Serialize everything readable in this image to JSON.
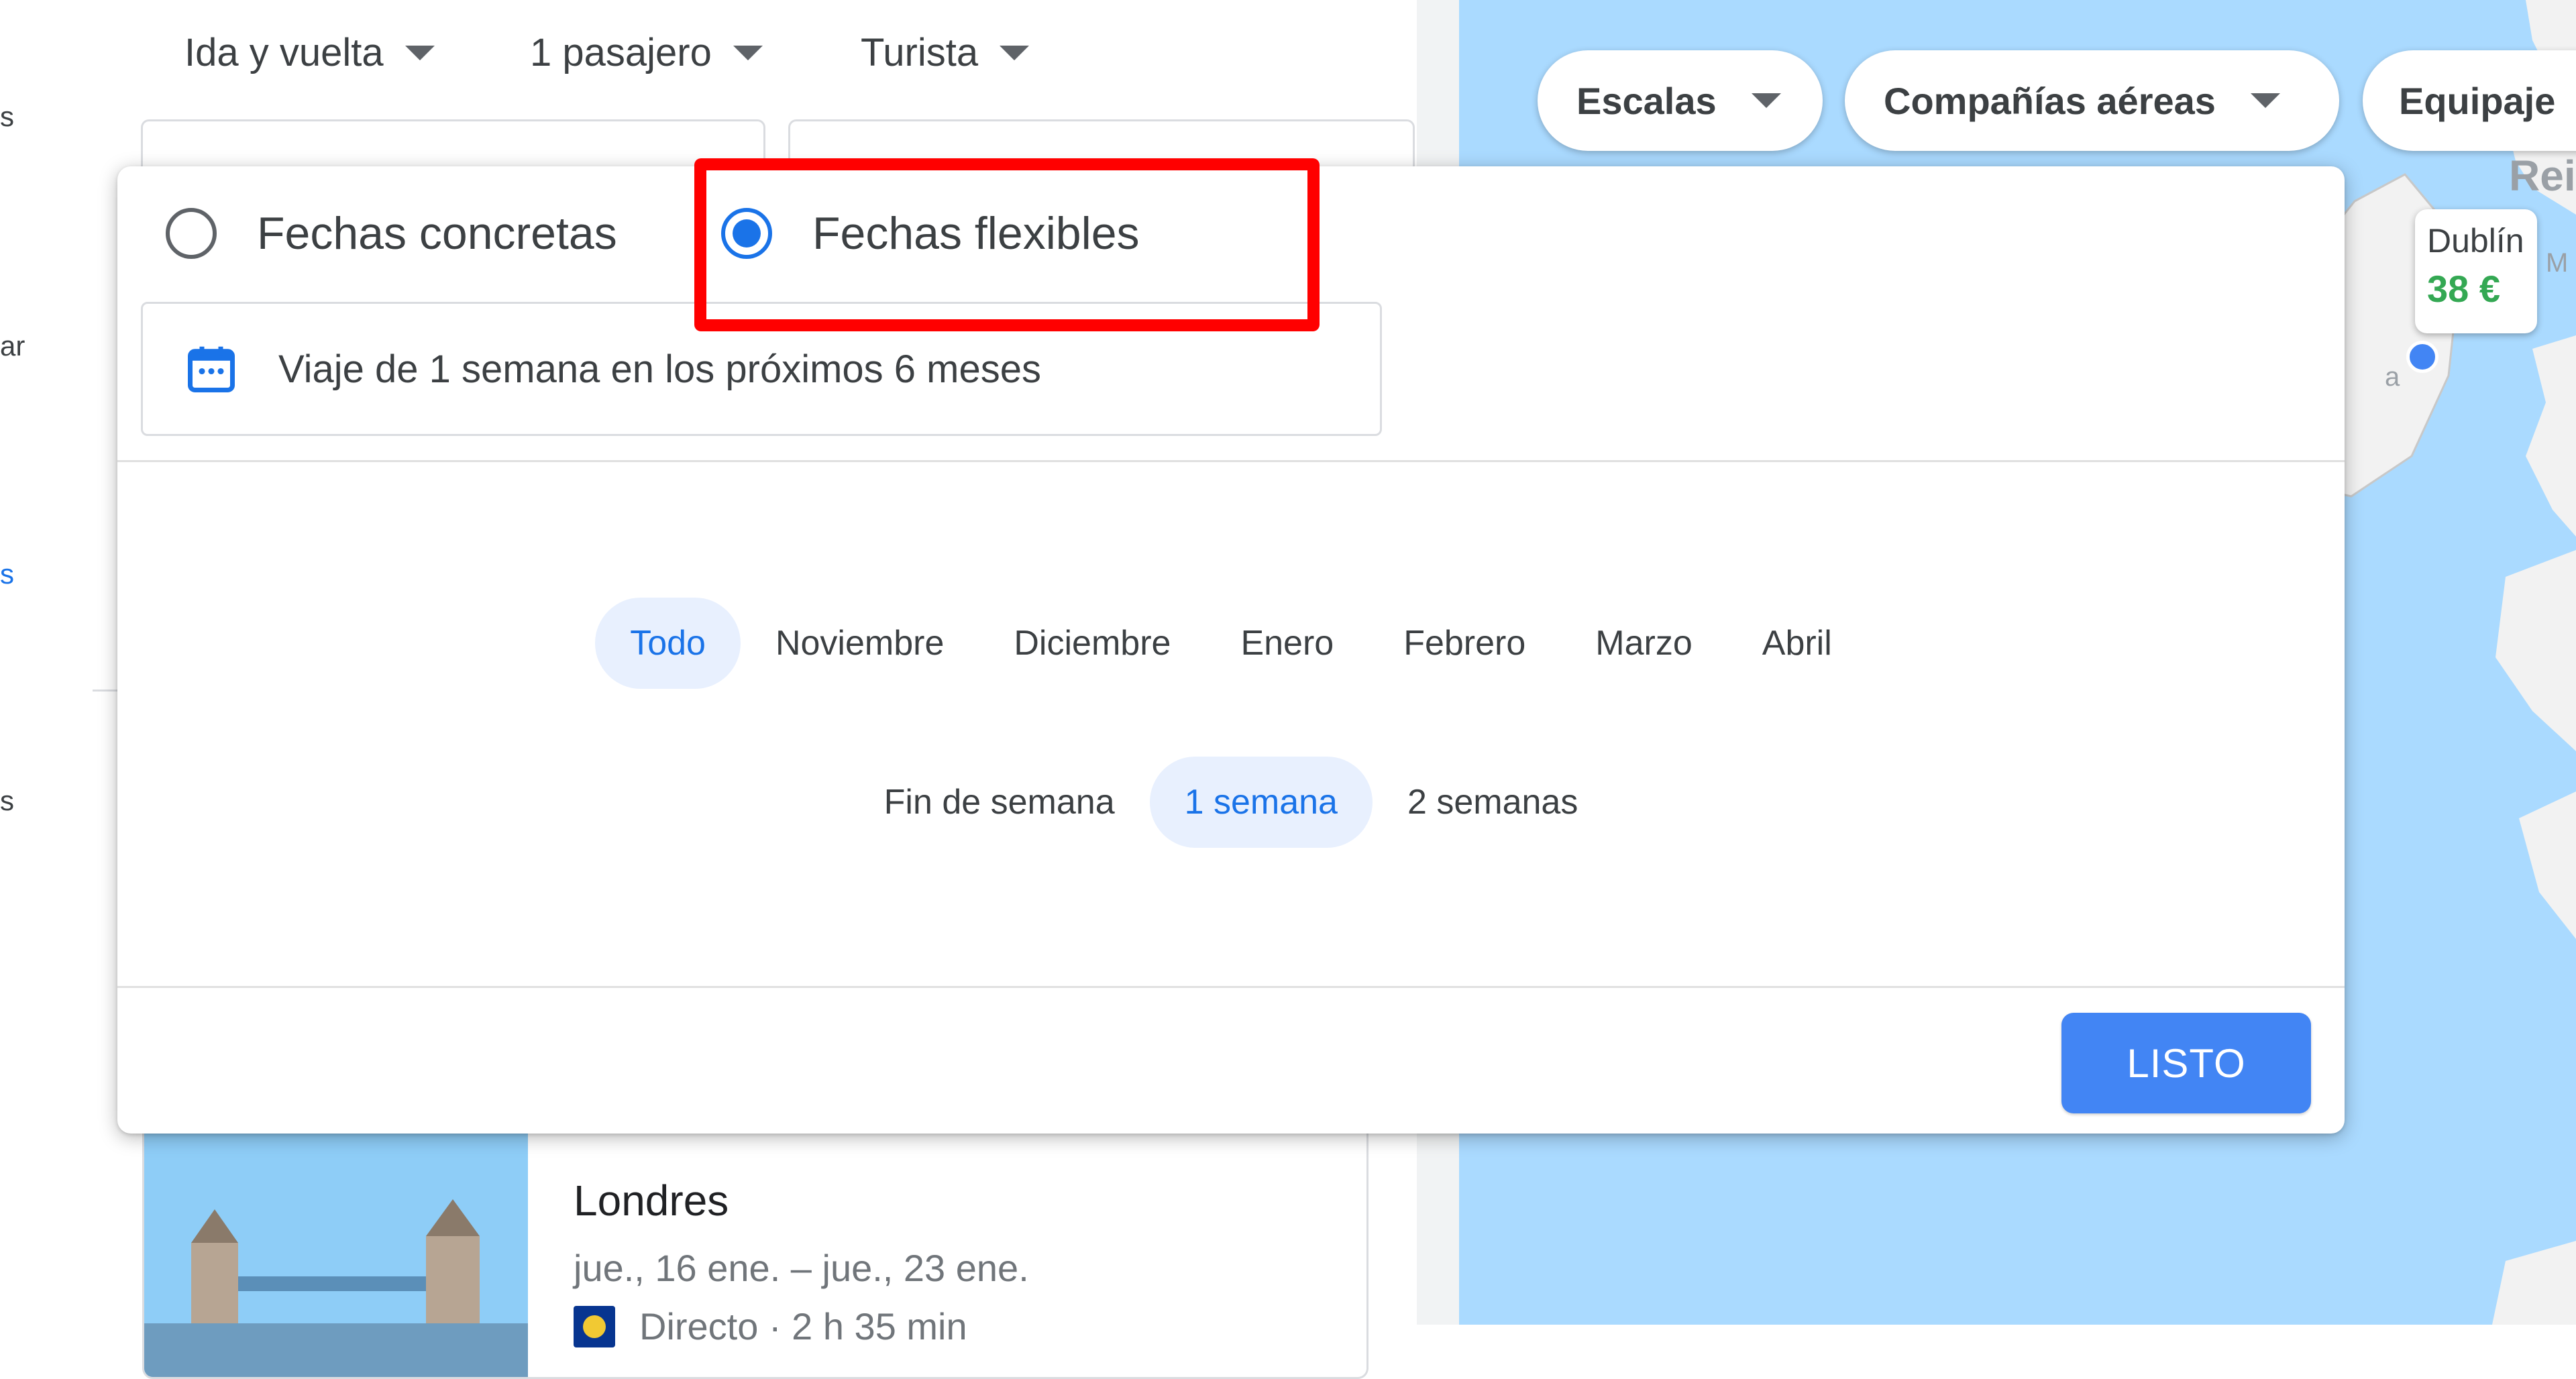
{
  "top_controls": {
    "trip_type": "Ida y vuelta",
    "passengers": "1 pasajero",
    "cabin": "Turista"
  },
  "sidebar_fragments": [
    "s",
    "ar",
    "s",
    "s"
  ],
  "map": {
    "filters": [
      "Escalas",
      "Compañías aéreas",
      "Equipaje"
    ],
    "destination_tag": {
      "city": "Dublín",
      "price": "38 €"
    },
    "fragments": [
      "Rei",
      "M",
      "a"
    ],
    "colors": {
      "water": "#aadaff",
      "land": "#f2f2f2",
      "price": "#34a853"
    }
  },
  "date_popup": {
    "mode_options": [
      {
        "label": "Fechas concretas",
        "selected": false
      },
      {
        "label": "Fechas flexibles",
        "selected": true
      }
    ],
    "summary": "Viaje de 1 semana en los próximos 6 meses",
    "months": [
      {
        "label": "Todo",
        "active": true
      },
      {
        "label": "Noviembre",
        "active": false
      },
      {
        "label": "Diciembre",
        "active": false
      },
      {
        "label": "Enero",
        "active": false
      },
      {
        "label": "Febrero",
        "active": false
      },
      {
        "label": "Marzo",
        "active": false
      },
      {
        "label": "Abril",
        "active": false
      }
    ],
    "durations": [
      {
        "label": "Fin de semana",
        "active": false
      },
      {
        "label": "1 semana",
        "active": true
      },
      {
        "label": "2 semanas",
        "active": false
      }
    ],
    "done_label": "LISTO",
    "accent": "#1a73e8",
    "highlight_color": "#ff0000"
  },
  "result_card": {
    "city": "Londres",
    "dates": "jue., 16 ene. – jue., 23 ene.",
    "route": "Directo · 2 h 35 min"
  }
}
